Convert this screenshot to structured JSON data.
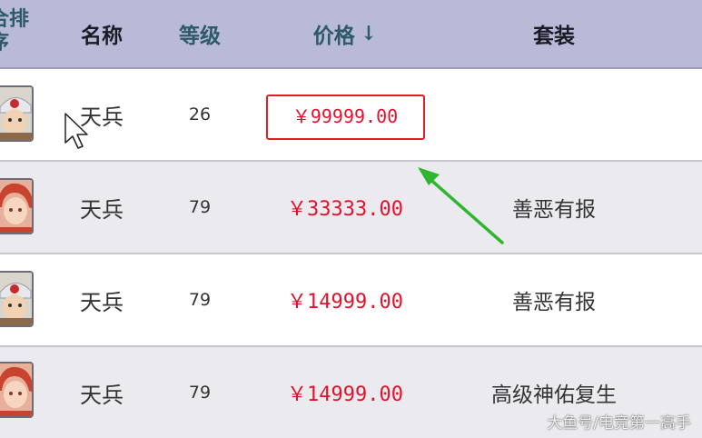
{
  "table": {
    "headers": {
      "rank": "合排序",
      "name": "名称",
      "level": "等级",
      "price": "价格",
      "price_sort_icon": "↓",
      "set": "套装"
    },
    "rows": [
      {
        "avatar": "helmet-warrior-avatar",
        "name": "天兵",
        "level": "26",
        "price": "￥99999.00",
        "set": ""
      },
      {
        "avatar": "red-hair-warrior-avatar",
        "name": "天兵",
        "level": "79",
        "price": "￥33333.00",
        "set": "善恶有报"
      },
      {
        "avatar": "helmet-warrior-avatar",
        "name": "天兵",
        "level": "79",
        "price": "￥14999.00",
        "set": "善恶有报"
      },
      {
        "avatar": "red-hair-warrior-avatar",
        "name": "天兵",
        "level": "79",
        "price": "￥14999.00",
        "set": "高级神佑复生"
      }
    ]
  },
  "annotation": {
    "highlight_color": "#e01e28",
    "arrow_color": "#2fb52f"
  },
  "colors": {
    "header_bg": "#b9bad8",
    "price": "#e0122e",
    "row_alt_bg": "#ebebef"
  },
  "watermark": "大鱼号/电竞第一高手"
}
